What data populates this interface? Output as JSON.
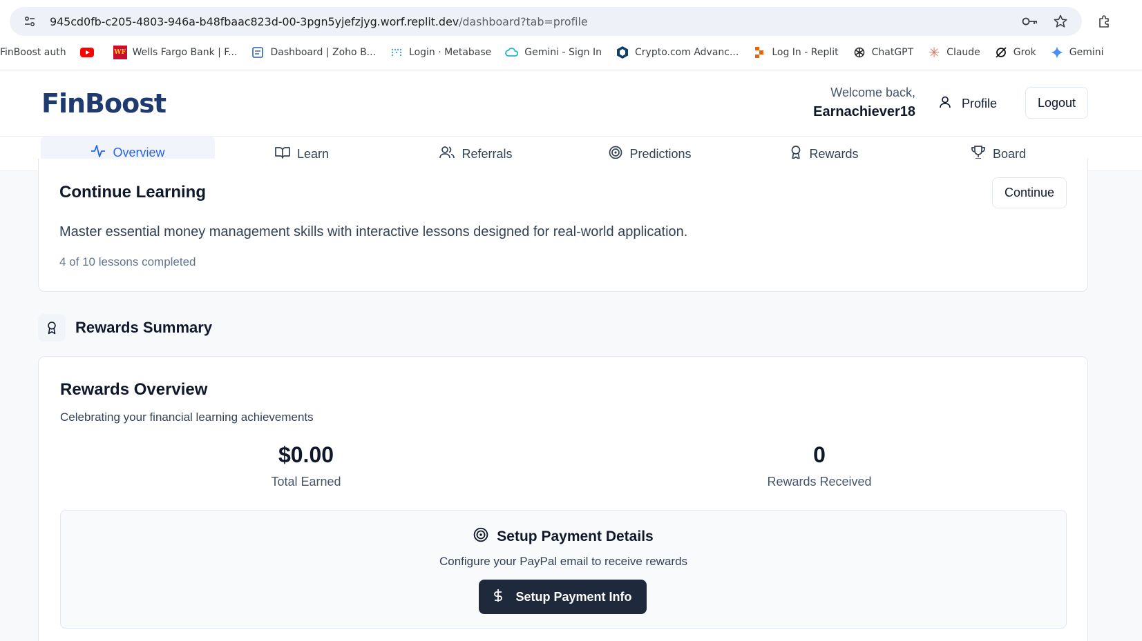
{
  "browser": {
    "url_host": "945cd0fb-c205-4803-946a-b48fbaac823d-00-3pgn5yjefzjyg.worf.replit.dev",
    "url_path": "/dashboard?tab=profile",
    "bookmarks": [
      {
        "label": "FinBoost auth",
        "icon": "none"
      },
      {
        "label": "",
        "icon": "youtube-icon"
      },
      {
        "label": "Wells Fargo Bank | F...",
        "icon": "wells-fargo-icon"
      },
      {
        "label": "Dashboard | Zoho B...",
        "icon": "zoho-icon"
      },
      {
        "label": "Login · Metabase",
        "icon": "metabase-icon"
      },
      {
        "label": "Gemini - Sign In",
        "icon": "gemini-cloud-icon"
      },
      {
        "label": "Crypto.com Advanc...",
        "icon": "crypto-icon"
      },
      {
        "label": "Log In - Replit",
        "icon": "replit-icon"
      },
      {
        "label": "ChatGPT",
        "icon": "chatgpt-icon"
      },
      {
        "label": "Claude",
        "icon": "claude-icon"
      },
      {
        "label": "Grok",
        "icon": "grok-icon"
      },
      {
        "label": "Gemini",
        "icon": "gemini-icon"
      }
    ]
  },
  "header": {
    "logo": "FinBoost",
    "welcome": "Welcome back,",
    "username": "Earnachiever18",
    "profile_label": "Profile",
    "logout_label": "Logout"
  },
  "tabs": [
    {
      "label": "Overview",
      "icon": "activity-icon",
      "active": true
    },
    {
      "label": "Learn",
      "icon": "book-icon",
      "active": false
    },
    {
      "label": "Referrals",
      "icon": "users-icon",
      "active": false
    },
    {
      "label": "Predictions",
      "icon": "target-icon",
      "active": false
    },
    {
      "label": "Rewards",
      "icon": "award-icon",
      "active": false
    },
    {
      "label": "Board",
      "icon": "trophy-icon",
      "active": false
    }
  ],
  "continue_learning": {
    "title": "Continue Learning",
    "button": "Continue",
    "description": "Master essential money management skills with interactive lessons designed for real-world application.",
    "progress": "4 of 10 lessons completed"
  },
  "rewards_summary": {
    "section_title": "Rewards Summary",
    "card_title": "Rewards Overview",
    "card_subtitle": "Celebrating your financial learning achievements",
    "total_earned_value": "$0.00",
    "total_earned_label": "Total Earned",
    "rewards_received_value": "0",
    "rewards_received_label": "Rewards Received",
    "payment": {
      "title": "Setup Payment Details",
      "subtitle": "Configure your PayPal email to receive rewards",
      "button": "Setup Payment Info"
    }
  },
  "colors": {
    "brand": "#1e3a6e",
    "accent": "#2563eb",
    "dark_button": "#1e293b"
  }
}
